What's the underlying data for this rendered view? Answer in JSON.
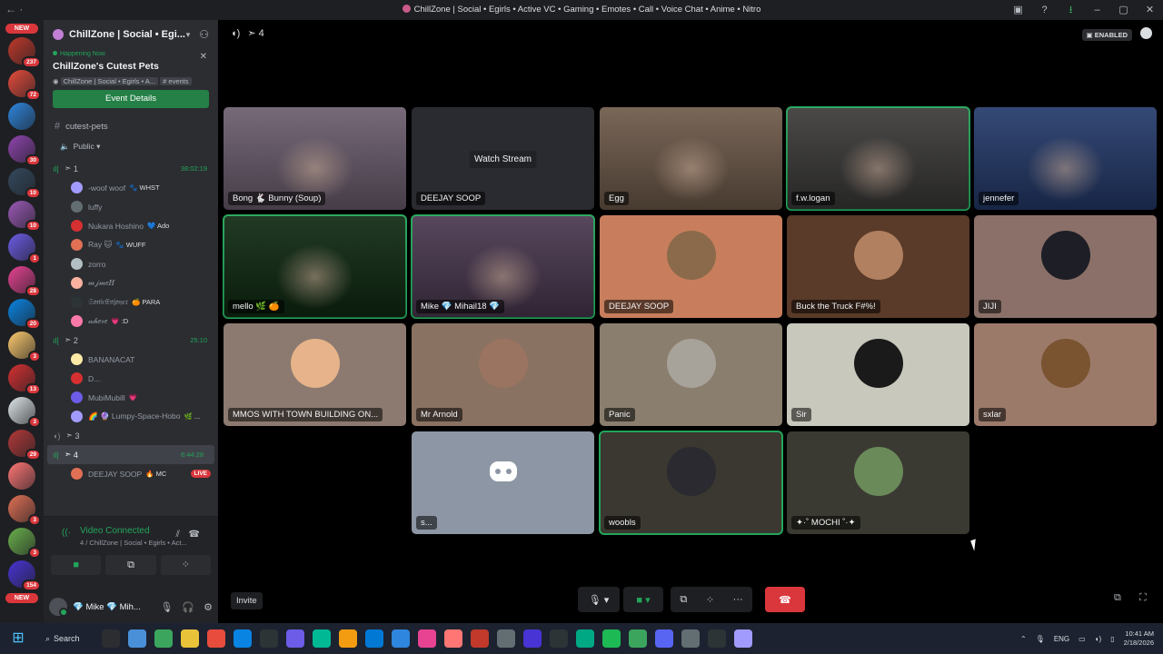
{
  "window": {
    "title": "ChillZone | Social • Egirls • Active VC • Gaming • Emotes • Call • Voice Chat • Anime • Nitro"
  },
  "rail": {
    "new_top": "NEW",
    "new_bottom": "NEW",
    "servers": [
      {
        "color": "#c0392b",
        "badge": "237"
      },
      {
        "color": "#e74c3c",
        "badge": "72"
      },
      {
        "color": "#2e86de",
        "badge": ""
      },
      {
        "color": "#8e44ad",
        "badge": "30"
      },
      {
        "color": "#34495e",
        "badge": "10"
      },
      {
        "color": "#9b59b6",
        "badge": "10"
      },
      {
        "color": "#6c5ce7",
        "badge": "1"
      },
      {
        "color": "#e84393",
        "badge": "28"
      },
      {
        "color": "#0984e3",
        "badge": "20"
      },
      {
        "color": "#fdcb6e",
        "badge": "3"
      },
      {
        "color": "#d63031",
        "badge": "13"
      },
      {
        "color": "#dfe6e9",
        "badge": "3"
      },
      {
        "color": "#b33939",
        "badge": "29"
      },
      {
        "color": "#ff7675",
        "badge": ""
      },
      {
        "color": "#e17055",
        "badge": "3"
      },
      {
        "color": "#6ab04c",
        "badge": "3"
      },
      {
        "color": "#4834d4",
        "badge": "154"
      }
    ]
  },
  "sidebar": {
    "guild_name": "ChillZone | Social • Egi...",
    "event": {
      "status": "Happening Now",
      "title": "ChillZone's Cutest Pets",
      "location": "ChillZone | Social • Egirls • A...",
      "location_channel": "# events",
      "button": "Event Details"
    },
    "text_channel": "cutest-pets",
    "public_label": "Public",
    "vc1": {
      "name": "1",
      "time": "38:02:19"
    },
    "vc1_members": [
      {
        "name": "-woof woof",
        "tag": "🐾 WHST",
        "color": "#a29bfe"
      },
      {
        "name": "luffy",
        "tag": "",
        "color": "#636e72"
      },
      {
        "name": "Nukara Hoshino",
        "tag": "💙 Ado",
        "color": "#d63031"
      },
      {
        "name": "Ray 🐱",
        "tag": "🐾 WUFF",
        "color": "#e17055"
      },
      {
        "name": "zorro",
        "tag": "",
        "color": "#b2bec3"
      },
      {
        "name": "𝓂𝒿𝓂𝑒𝐻",
        "tag": "",
        "color": "#fab1a0"
      },
      {
        "name": "𝔖𝔬𝔫𝔦𝔠𝔈𝔫𝔧𝔬𝔶𝔢𝔯",
        "tag": "🍊 PARA",
        "color": "#2d3436"
      },
      {
        "name": "𝓌𝒽𝑒𝓇𝑒",
        "tag": "💗 :D",
        "color": "#fd79a8"
      }
    ],
    "vc2": {
      "name": "2",
      "time": "25:10"
    },
    "vc2_members": [
      {
        "name": "BANANACAT",
        "tag": "",
        "color": "#ffeaa7"
      },
      {
        "name": "D...",
        "tag": "",
        "color": "#d63031"
      },
      {
        "name": "MubiMubill",
        "tag": "💗",
        "color": "#6c5ce7"
      },
      {
        "name": "🌈 🔮 Lumpy-Space-Hobo",
        "tag": "🌿 ...",
        "color": "#a29bfe"
      }
    ],
    "vc3": {
      "name": "3"
    },
    "vc4": {
      "name": "4",
      "time": "6:44:28"
    },
    "vc4_members": [
      {
        "name": "DEEJAY SOOP",
        "tag": "🔥 MC",
        "color": "#e17055",
        "live": "LIVE"
      }
    ],
    "voice": {
      "title": "Video Connected",
      "subtitle": "4 / ChillZone | Social • Egirls • Act..."
    },
    "user": {
      "name": "💎 Mike 💎 Mih..."
    }
  },
  "stage": {
    "channel": "4",
    "enabled_label": "ENABLED",
    "invite": "Invite",
    "tiles": [
      {
        "label": "Bong 🐇 Bunny (Soup)",
        "bg": "#6b5d6e",
        "kind": "cam",
        "speaking": false
      },
      {
        "label": "DEEJAY SOOP",
        "bg": "#2a2b30",
        "kind": "stream",
        "watch": "Watch Stream",
        "speaking": false
      },
      {
        "label": "Egg",
        "bg": "#6e5a4a",
        "kind": "cam",
        "speaking": false
      },
      {
        "label": "f.w.logan",
        "bg": "#3b3a39",
        "kind": "cam",
        "speaking": true
      },
      {
        "label": "jennefer",
        "bg": "#243a6b",
        "kind": "cam",
        "speaking": false
      },
      {
        "label": "mello 🌿 🍊",
        "bg": "#0f2a12",
        "kind": "cam",
        "speaking": true
      },
      {
        "label": "Mike 💎 Mihail18 💎",
        "bg": "#4a3850",
        "kind": "cam",
        "speaking": true
      },
      {
        "label": "DEEJAY SOOP",
        "bg": "#c87e5c",
        "kind": "avatar",
        "avatar": "#8a6a4a",
        "speaking": false
      },
      {
        "label": "Buck the Truck F#%!",
        "bg": "#5a3a28",
        "kind": "avatar",
        "avatar": "#b08060",
        "speaking": false
      },
      {
        "label": "JIJI",
        "bg": "#8a7068",
        "kind": "avatar",
        "avatar": "#1e1e26",
        "speaking": false
      },
      {
        "label": "MMOS WITH TOWN BUILDING ON...",
        "bg": "#8c7a70",
        "kind": "avatar",
        "avatar": "#e6b38a",
        "speaking": false
      },
      {
        "label": "Mr Arnold",
        "bg": "#8a7262",
        "kind": "avatar",
        "avatar": "#9a7460",
        "speaking": false
      },
      {
        "label": "Panic",
        "bg": "#8a7e6e",
        "kind": "avatar",
        "avatar": "#a7a29a",
        "speaking": false
      },
      {
        "label": "Sir",
        "bg": "#c9c8bd",
        "kind": "avatar",
        "avatar": "#1a1a1a",
        "speaking": false
      },
      {
        "label": "sxlar",
        "bg": "#9c7a6a",
        "kind": "avatar",
        "avatar": "#7a5430",
        "speaking": false
      },
      {
        "label": "s...",
        "bg": "#8d96a4",
        "kind": "discord",
        "avatar": "#5865f2",
        "speaking": false
      },
      {
        "label": "woobls",
        "bg": "#3a3830",
        "kind": "avatar",
        "avatar": "#2a2a30",
        "speaking": true
      },
      {
        "label": "✦·˚ MOCHI ˚·✦",
        "bg": "#3a3a32",
        "kind": "avatar",
        "avatar": "#6a8a5a",
        "speaking": false
      }
    ]
  },
  "taskbar": {
    "search": "Search",
    "lang": "ENG",
    "time": "10:41 AM",
    "date": "2/18/2026"
  }
}
